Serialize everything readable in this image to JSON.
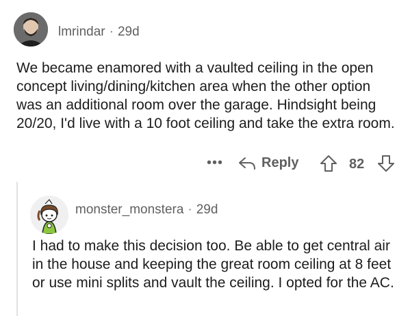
{
  "comment": {
    "username": "lmrindar",
    "age": "29d",
    "body": "We became enamored with a vaulted ceiling in the open concept living/dining/kitchen area when the other option was an additional room over the garage. Hindsight being 20/20, I'd live with a 10 foot ceiling and take the extra room.",
    "actions": {
      "more_label": "•••",
      "reply_label": "Reply",
      "score": "82"
    }
  },
  "reply": {
    "username": "monster_monstera",
    "age": "29d",
    "body": "I had to make this decision too. Be able to get central air in the house and keeping the great room ceiling at 8 feet or use mini splits and vault the ceiling. I opted for the AC."
  },
  "separator": "·",
  "icons": {
    "reply": "reply-arrow-icon",
    "upvote": "upvote-arrow-icon",
    "downvote": "downvote-arrow-icon"
  },
  "colors": {
    "text": "#1c1c1c",
    "meta": "#5f5f5f",
    "thread_line": "#e1e1e1"
  }
}
